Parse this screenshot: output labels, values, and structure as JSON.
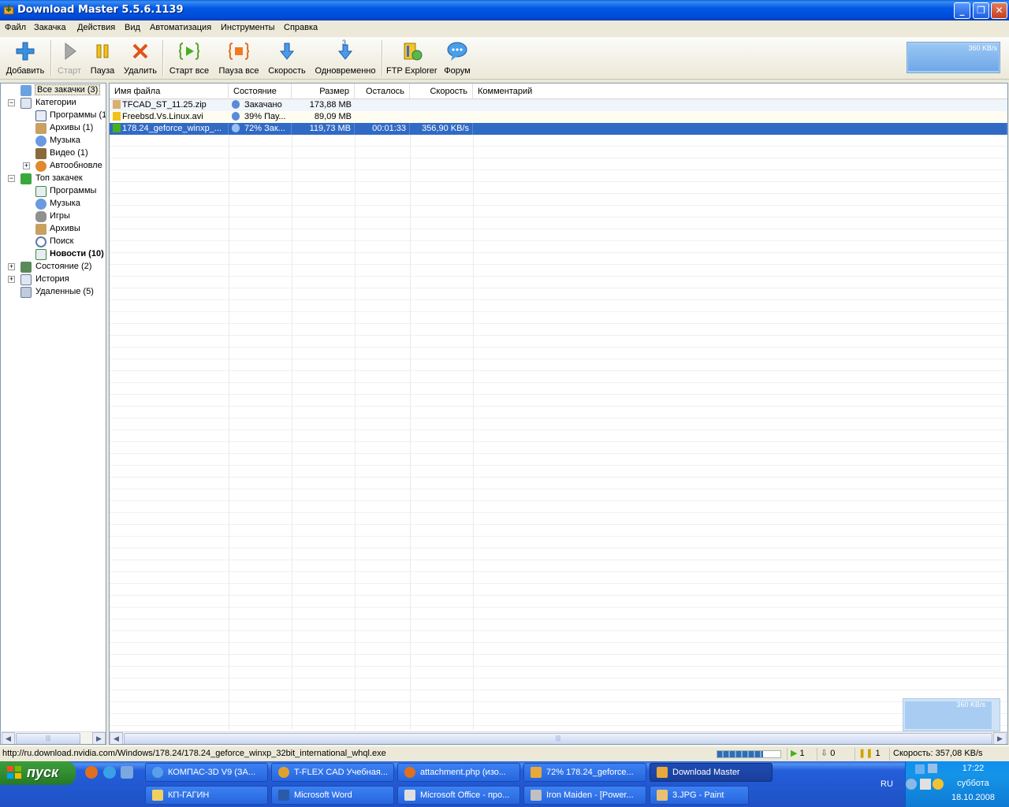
{
  "window": {
    "title": "Download Master 5.5.6.1139"
  },
  "menu": [
    "Файл",
    "Закачка",
    "Действия",
    "Вид",
    "Автоматизация",
    "Инструменты",
    "Справка"
  ],
  "toolbar": {
    "add": "Добавить",
    "start": "Старт",
    "pause": "Пауза",
    "delete": "Удалить",
    "start_all": "Старт все",
    "pause_all": "Пауза все",
    "speed": "Скорость",
    "simultaneous": "Одновременно",
    "simultaneous_count": "3",
    "ftp": "FTP Explorer",
    "forum": "Форум",
    "speed_graph_label": "360 KB/s"
  },
  "tree": {
    "all": "Все закачки (3)",
    "categories": "Категории",
    "programs": "Программы (1",
    "archives": "Архивы (1)",
    "music": "Музыка",
    "video": "Видео (1)",
    "autoupdate": "Автообновле",
    "top": "Топ закачек",
    "top_programs": "Программы",
    "top_music": "Музыка",
    "top_games": "Игры",
    "top_archives": "Архивы",
    "top_search": "Поиск",
    "top_news": "Новости (10)",
    "state": "Состояние (2)",
    "history": "История",
    "deleted": "Удаленные (5)"
  },
  "columns": {
    "name": "Имя файла",
    "status": "Состояние",
    "size": "Размер",
    "remaining": "Осталось",
    "speed": "Скорость",
    "comment": "Комментарий"
  },
  "downloads": [
    {
      "name": "TFCAD_ST_11.25.zip",
      "status": "Закачано",
      "size": "173,88 MB",
      "remaining": "",
      "speed": "",
      "comment": ""
    },
    {
      "name": "Freebsd.Vs.Linux.avi",
      "status": "39% Пау...",
      "size": "89,09 MB",
      "remaining": "",
      "speed": "",
      "comment": ""
    },
    {
      "name": "178.24_geforce_winxp_...",
      "status": "72% Зак...",
      "size": "119,73 MB",
      "remaining": "00:01:33",
      "speed": "356,90 KB/s",
      "comment": ""
    }
  ],
  "mini_graph_label": "360 KB/s",
  "statusbar": {
    "url": "http://ru.download.nvidia.com/Windows/178.24/178.24_geforce_winxp_32bit_international_whql.exe",
    "active": "1",
    "queued": "0",
    "paused": "1",
    "speed": "Скорость: 357,08 KB/s",
    "progress": 0.72
  },
  "taskbar": {
    "start": "пуск",
    "tasks_row1": [
      "КОМПАС-3D V9 (ЗА...",
      "T-FLEX CAD Учебная...",
      "attachment.php (изо...",
      "72% 178.24_geforce...",
      "Download Master"
    ],
    "tasks_row2": [
      "КП-ГАГИН",
      "Microsoft Word",
      "Microsoft Office - про...",
      "Iron Maiden - [Power...",
      "3.JPG - Paint"
    ],
    "lang": "RU",
    "time": "17:22",
    "day": "суббота",
    "date": "18.10.2008"
  }
}
